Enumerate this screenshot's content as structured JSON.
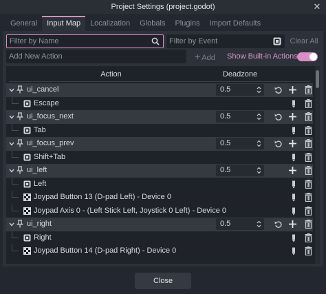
{
  "window": {
    "title": "Project Settings (project.godot)"
  },
  "tabs": [
    {
      "label": "General",
      "active": false
    },
    {
      "label": "Input Map",
      "active": true
    },
    {
      "label": "Localization",
      "active": false
    },
    {
      "label": "Globals",
      "active": false
    },
    {
      "label": "Plugins",
      "active": false
    },
    {
      "label": "Import Defaults",
      "active": false
    }
  ],
  "filters": {
    "name_placeholder": "Filter by Name",
    "name_value": "",
    "event_placeholder": "Filter by Event",
    "event_value": "",
    "clear_all_label": "Clear All"
  },
  "add_action": {
    "placeholder": "Add New Action",
    "value": "",
    "add_label": "Add",
    "show_builtin_label": "Show Built-in Actions",
    "show_builtin_enabled": true
  },
  "tree": {
    "columns": {
      "action": "Action",
      "deadzone": "Deadzone"
    },
    "rows": [
      {
        "type": "action",
        "name": "ui_cancel",
        "deadzone": "0.5",
        "revert": true
      },
      {
        "type": "event",
        "name": "Escape",
        "icon": "keyboard-icon"
      },
      {
        "type": "action",
        "name": "ui_focus_next",
        "deadzone": "0.5",
        "revert": true
      },
      {
        "type": "event",
        "name": "Tab",
        "icon": "keyboard-icon"
      },
      {
        "type": "action",
        "name": "ui_focus_prev",
        "deadzone": "0.5",
        "revert": true
      },
      {
        "type": "event",
        "name": "Shift+Tab",
        "icon": "keyboard-icon"
      },
      {
        "type": "action",
        "name": "ui_left",
        "deadzone": "0.5",
        "revert": false
      },
      {
        "type": "event",
        "name": "Left",
        "icon": "keyboard-icon"
      },
      {
        "type": "event",
        "name": "Joypad Button 13 (D-pad Left) - Device 0",
        "icon": "joypad-icon"
      },
      {
        "type": "event",
        "name": "Joypad Axis 0 - (Left Stick Left, Joystick 0 Left) - Device 0",
        "icon": "joypad-icon"
      },
      {
        "type": "action",
        "name": "ui_right",
        "deadzone": "0.5",
        "revert": true
      },
      {
        "type": "event",
        "name": "Right",
        "icon": "keyboard-icon"
      },
      {
        "type": "event",
        "name": "Joypad Button 14 (D-pad Right) - Device 0",
        "icon": "joypad-icon"
      }
    ]
  },
  "footer": {
    "close_label": "Close"
  },
  "colors": {
    "accent": "#d58fc3",
    "background": "#1d2026",
    "panel": "#2d3139"
  }
}
